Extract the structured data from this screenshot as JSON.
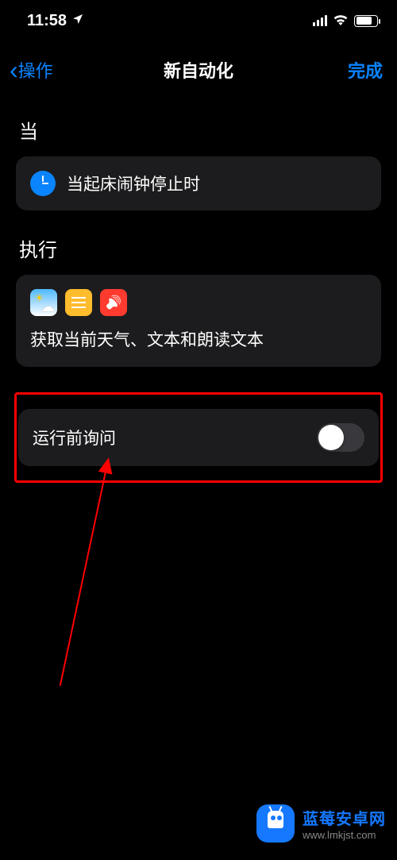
{
  "statusBar": {
    "time": "11:58"
  },
  "nav": {
    "back": "操作",
    "title": "新自动化",
    "done": "完成"
  },
  "sections": {
    "when": {
      "label": "当",
      "item": "当起床闹钟停止时"
    },
    "exec": {
      "label": "执行",
      "summary": "获取当前天气、文本和朗读文本"
    }
  },
  "toggle": {
    "label": "运行前询问",
    "on": false
  },
  "watermark": {
    "title": "蓝莓安卓网",
    "url": "www.lmkjst.com"
  }
}
